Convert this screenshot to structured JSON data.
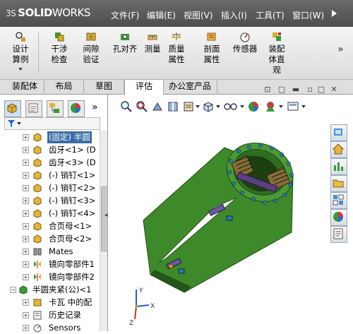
{
  "app": {
    "logo_prefix": "3S",
    "logo_solid": "SOLID",
    "logo_works": "WORKS"
  },
  "menu": [
    "文件(F)",
    "编辑(E)",
    "视图(V)",
    "插入(I)",
    "工具(T)",
    "窗口(W)"
  ],
  "toolbar": {
    "design_study": "设计算例",
    "items": [
      "干涉检查",
      "间隙验证",
      "孔对齐",
      "测量",
      "质量属性",
      "剖面属性",
      "传感器",
      "装配体直观"
    ],
    "more": "»"
  },
  "tabs": [
    "装配体",
    "布局",
    "草图",
    "评估",
    "办公室产品"
  ],
  "active_tab": "评估",
  "featuremanager": {
    "more": "»",
    "filter_icon": "filter-icon",
    "tree": [
      {
        "label": "(固定) 半圆",
        "icon": "part",
        "selected": true
      },
      {
        "label": "齿牙<1> (D",
        "icon": "part"
      },
      {
        "label": "齿牙<3> (D",
        "icon": "part"
      },
      {
        "label": "(-) 销钉<1>",
        "icon": "part"
      },
      {
        "label": "(-) 销钉<2>",
        "icon": "part"
      },
      {
        "label": "(-) 销钉<3>",
        "icon": "part"
      },
      {
        "label": "(-) 销钉<4>",
        "icon": "part"
      },
      {
        "label": "合页母<1>",
        "icon": "part"
      },
      {
        "label": "合页母<2>",
        "icon": "part"
      },
      {
        "label": "Mates",
        "icon": "mates"
      },
      {
        "label": "镜向零部件1",
        "icon": "mirror"
      },
      {
        "label": "镜向零部件2",
        "icon": "mirror"
      },
      {
        "label": "半圆夹紧(公)<1",
        "icon": "part-root"
      },
      {
        "label": "卡瓦 中的配",
        "icon": "part"
      },
      {
        "label": "历史记录",
        "icon": "history"
      },
      {
        "label": "Sensors",
        "icon": "sensor"
      }
    ]
  },
  "axes": {
    "x": "X",
    "y": "Y",
    "z": "Z"
  },
  "colors": {
    "model_green": "#3e8a2a",
    "model_dark": "#23561a",
    "accent": "#3a6ea5"
  }
}
